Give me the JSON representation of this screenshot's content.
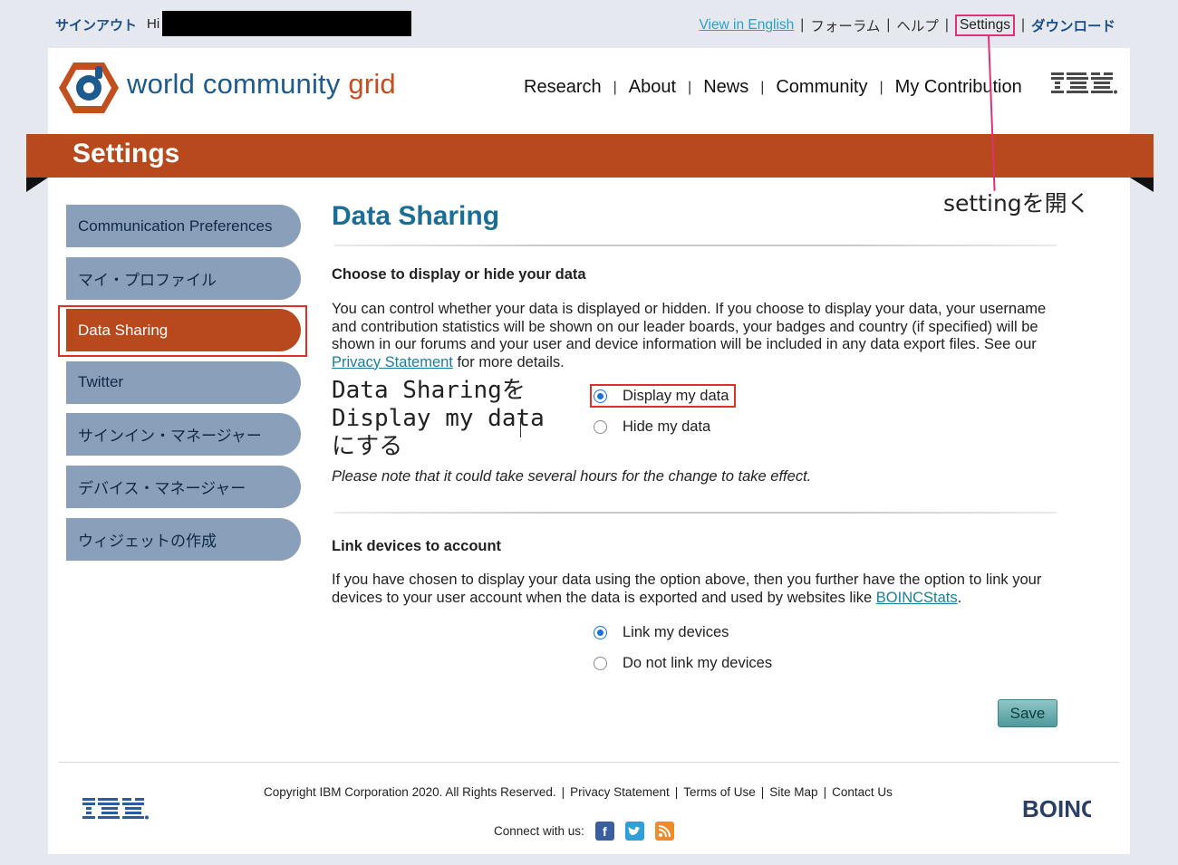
{
  "topbar": {
    "signout": "サインアウト",
    "hi": "Hi",
    "view_in_english": "View in English",
    "forum": "フォーラム",
    "help": "ヘルプ",
    "settings": "Settings",
    "download": "ダウンロード"
  },
  "brand": {
    "word1": "world community",
    "word2": " grid",
    "ibm": "IBM"
  },
  "nav": {
    "items": [
      "Research",
      "About",
      "News",
      "Community",
      "My Contribution"
    ]
  },
  "band": {
    "title": "Settings"
  },
  "sidebar": {
    "items": [
      {
        "label": "Communication Preferences"
      },
      {
        "label": "マイ・プロファイル"
      },
      {
        "label": "Data Sharing"
      },
      {
        "label": "Twitter"
      },
      {
        "label": "サインイン・マネージャー"
      },
      {
        "label": "デバイス・マネージャー"
      },
      {
        "label": "ウィジェットの作成"
      }
    ],
    "active_index": 2
  },
  "main": {
    "title": "Data Sharing",
    "section1": {
      "heading": "Choose to display or hide your data",
      "body": "You can control whether your data is displayed or hidden. If you choose to display your data, your username and contribution statistics will be shown on our leader boards, your badges and country (if specified) will be shown in our forums and your user and device information will be included in any data export files. See our ",
      "link": "Privacy Statement",
      "body_tail": " for more details.",
      "options": [
        "Display my data",
        "Hide my data"
      ],
      "selected": "Display my data",
      "note": "Please note that it could take several hours for the change to take effect."
    },
    "section2": {
      "heading": "Link devices to account",
      "body": "If you have chosen to display your data using the option above, then you further have the option to link your devices to your user account when the data is exported and used by websites like ",
      "link": "BOINCStats",
      "body_tail": ".",
      "options": [
        "Link my devices",
        "Do not link my devices"
      ],
      "selected": "Link my devices"
    },
    "save": "Save"
  },
  "annotations": {
    "left_line1": "Data Sharingを",
    "left_line2": "Display my data",
    "left_line3": "にする",
    "right": "settingを開く"
  },
  "footer": {
    "copyright": "Copyright IBM Corporation 2020.  All Rights Reserved.",
    "links": [
      "Privacy Statement",
      "Terms of Use",
      "Site Map",
      "Contact Us"
    ],
    "connect": "Connect with us:",
    "boinc": "BOINC"
  },
  "colors": {
    "accent_orange": "#b7491c",
    "sidebar_blue": "#8a9fb9",
    "title_blue": "#1a6d95",
    "highlight_red": "#e0302a",
    "highlight_pink": "#e0307a"
  }
}
